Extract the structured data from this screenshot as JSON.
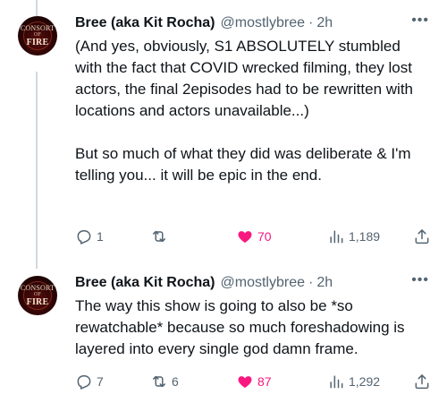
{
  "tweets": [
    {
      "author": {
        "name": "Bree (aka Kit Rocha)",
        "handle": "@mostlybree",
        "separator": "·",
        "time": "2h",
        "avatar_text": [
          "CONSORT",
          "OF",
          "FIRE"
        ]
      },
      "more_label": "•••",
      "text": "(And yes, obviously, S1 ABSOLUTELY stumbled with the fact that COVID wrecked filming, they lost actors, the final 2episodes had to be rewritten with locations and actors unavailable...)\n\nBut so much of what they did was deliberate & I'm telling you... it will be epic in the end.",
      "stats": {
        "replies": "1",
        "reposts": "",
        "likes": "70",
        "views": "1,189"
      },
      "liked": true
    },
    {
      "author": {
        "name": "Bree (aka Kit Rocha)",
        "handle": "@mostlybree",
        "separator": "·",
        "time": "2h",
        "avatar_text": [
          "CONSORT",
          "OF",
          "FIRE"
        ]
      },
      "more_label": "•••",
      "text": "The way this show is going to also be *so rewatchable* because so much foreshadowing is layered into every single god damn frame.",
      "stats": {
        "replies": "7",
        "reposts": "6",
        "likes": "87",
        "views": "1,292"
      },
      "liked": true
    }
  ],
  "colors": {
    "like": "#f91880",
    "muted": "#536471",
    "text": "#0f1419",
    "thread_line": "#cfd9de"
  },
  "icons": [
    "reply-icon",
    "retweet-icon",
    "heart-icon",
    "views-icon",
    "share-icon",
    "more-icon"
  ]
}
